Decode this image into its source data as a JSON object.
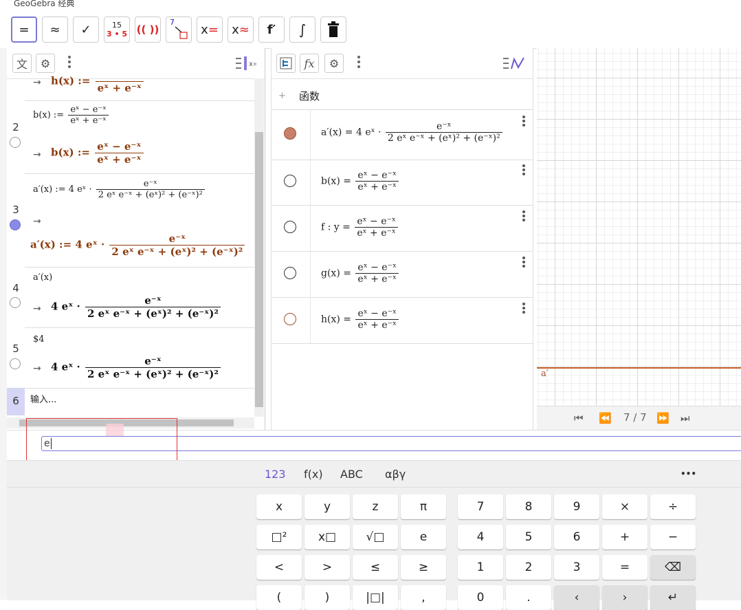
{
  "window": {
    "title": "GeoGebra 经典"
  },
  "toolbar": {
    "eval_label": "=",
    "numeric_label": "≈",
    "keep_input_label": "✓",
    "factor_top": "15",
    "factor_bottom": "3 • 5",
    "expand_label": "(( ))",
    "substitute_label": "7",
    "solve_label": "x",
    "solve_eq": "=",
    "nsolve_label": "x",
    "nsolve_eq": "≈",
    "derivative_label": "f′",
    "integral_label": "∫"
  },
  "cas": {
    "header_text_icon": "文",
    "rows": [
      {
        "num": "",
        "out_name": "h(x)",
        "out_assign": ":=",
        "out_den": "eˣ + e⁻ˣ"
      },
      {
        "num": "2",
        "in_name": "b(x) :=",
        "in_num": "eˣ − e⁻ˣ",
        "in_den": "eˣ + e⁻ˣ",
        "out_name": "b(x)",
        "out_assign": ":=",
        "out_num": "eˣ − e⁻ˣ",
        "out_den": "eˣ + e⁻ˣ"
      },
      {
        "num": "3",
        "in_name": "a′(x) := 4 eˣ ·",
        "in_num": "e⁻ˣ",
        "in_den": "2 eˣ e⁻ˣ + (eˣ)² + (e⁻ˣ)²",
        "out_name": "a′(x)",
        "out_assign": ":=",
        "out_pre": "4 eˣ ·",
        "out_num": "e⁻ˣ",
        "out_den": "2 eˣ e⁻ˣ + (eˣ)² + (e⁻ˣ)²"
      },
      {
        "num": "4",
        "in_text": "a′(x)",
        "out_pre": "4 eˣ ·",
        "out_num": "e⁻ˣ",
        "out_den": "2 eˣ e⁻ˣ + (eˣ)² + (e⁻ˣ)²"
      },
      {
        "num": "5",
        "in_text": "$4",
        "out_pre": "4 eˣ ·",
        "out_num": "e⁻ˣ",
        "out_den": "2 eˣ e⁻ˣ + (eˣ)² + (e⁻ˣ)²"
      },
      {
        "num": "6",
        "placeholder": "输入..."
      }
    ],
    "arrow": "→"
  },
  "algebra": {
    "header_fx": "fx",
    "group_label": "函数",
    "items": [
      {
        "lhs": "a′(x)  =  4 eˣ ·",
        "num": "e⁻ˣ",
        "den": "2 eˣ e⁻ˣ + (eˣ)² + (e⁻ˣ)²",
        "color": "#c7806a",
        "filled": true
      },
      {
        "lhs": "b(x)  =",
        "num": "eˣ − e⁻ˣ",
        "den": "eˣ + e⁻ˣ",
        "color": "#222222",
        "filled": false
      },
      {
        "lhs": "f : y =",
        "num": "eˣ − e⁻ˣ",
        "den": "eˣ + e⁻ˣ",
        "color": "#222222",
        "filled": false
      },
      {
        "lhs": "g(x)  =",
        "num": "eˣ − e⁻ˣ",
        "den": "eˣ + e⁻ˣ",
        "color": "#222222",
        "filled": false
      },
      {
        "lhs": "h(x)  =",
        "num": "eˣ − e⁻ˣ",
        "den": "eˣ + e⁻ˣ",
        "color": "#a0522d",
        "filled": false
      }
    ]
  },
  "graphics": {
    "curve_label": "a′",
    "curve_color": "#c8642a",
    "page_indicator": "7 / 7"
  },
  "input": {
    "value": "e"
  },
  "keyboard": {
    "tabs": [
      "123",
      "f(x)",
      "ABC",
      "αβγ"
    ],
    "more": "•••",
    "left_keys": [
      "x",
      "y",
      "z",
      "π",
      "□²",
      "x□",
      "√□",
      "e",
      "<",
      ">",
      "≤",
      "≥",
      "(",
      ")",
      "|□|",
      ","
    ],
    "right_keys": [
      "7",
      "8",
      "9",
      "×",
      "÷",
      "4",
      "5",
      "6",
      "+",
      "−",
      "1",
      "2",
      "3",
      "=",
      "⌫",
      "0",
      ".",
      "‹",
      "›",
      "↵"
    ]
  },
  "colors": {
    "accent": "#6557d2",
    "output": "#8b3a0a"
  }
}
